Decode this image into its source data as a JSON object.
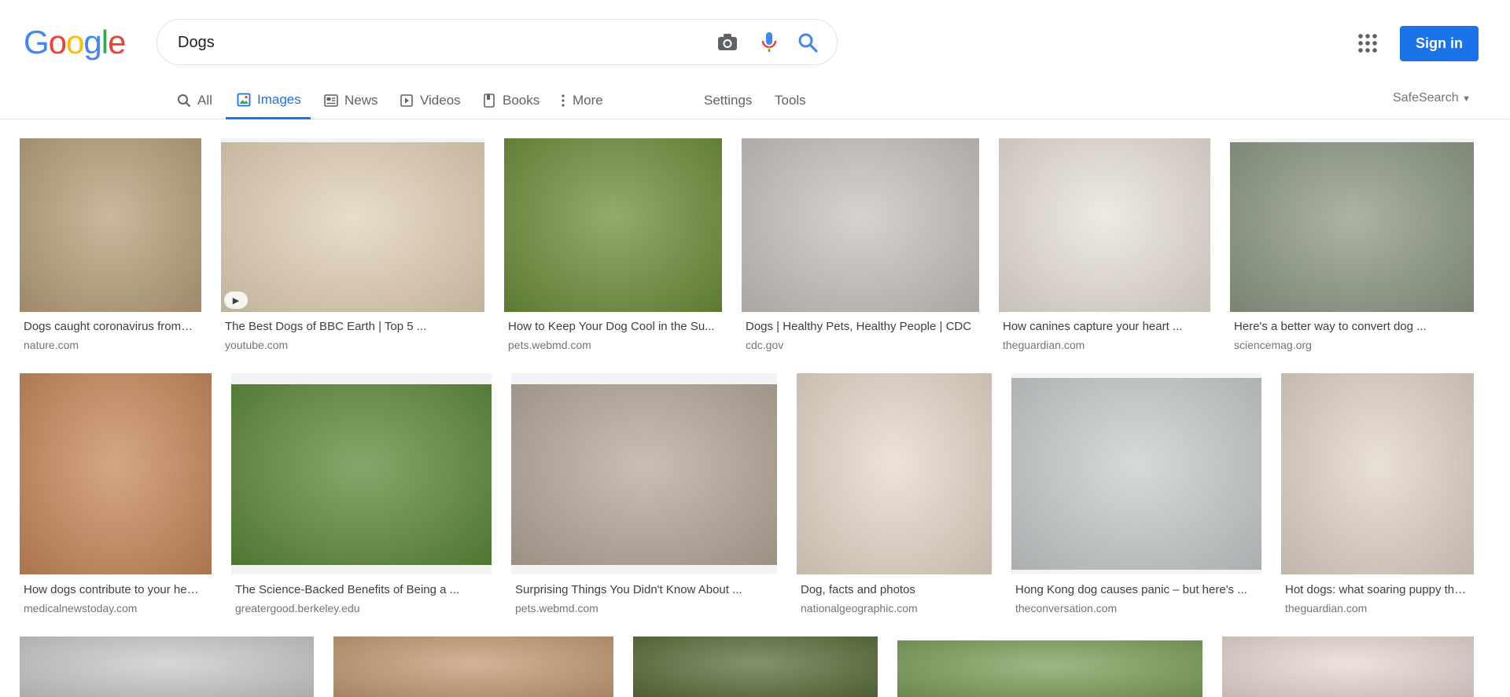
{
  "logo": [
    "G",
    "o",
    "o",
    "g",
    "l",
    "e"
  ],
  "logo_colors": [
    "#4285F4",
    "#EA4335",
    "#FBBC05",
    "#4285F4",
    "#34A853",
    "#EA4335"
  ],
  "search": {
    "value": "Dogs"
  },
  "signin_label": "Sign in",
  "tabs": [
    {
      "label": "All",
      "icon": "search-icon"
    },
    {
      "label": "Images",
      "icon": "image-icon"
    },
    {
      "label": "News",
      "icon": "news-icon"
    },
    {
      "label": "Videos",
      "icon": "video-icon"
    },
    {
      "label": "Books",
      "icon": "book-icon"
    },
    {
      "label": "More",
      "icon": "more-vert-icon"
    },
    {
      "label": "Settings"
    },
    {
      "label": "Tools"
    }
  ],
  "safesearch_label": "SafeSearch",
  "accent": "#1a73e8",
  "results": [
    {
      "title": "Dogs caught coronavirus from…",
      "source": "nature.com",
      "bg": "#b9a17c"
    },
    {
      "title": "The Best Dogs of BBC Earth | Top 5 ...",
      "source": "youtube.com",
      "bg": "#e3d2b6",
      "video": true
    },
    {
      "title": "How to Keep Your Dog Cool in the Su...",
      "source": "pets.webmd.com",
      "bg": "#6d8f3a"
    },
    {
      "title": "Dogs | Healthy Pets, Healthy People | CDC",
      "source": "cdc.gov",
      "bg": "#c7c3bf"
    },
    {
      "title": "How canines capture your heart ...",
      "source": "theguardian.com",
      "bg": "#e9e2d8"
    },
    {
      "title": "Here's a better way to convert dog ...",
      "source": "sciencemag.org",
      "bg": "#8e9a86"
    },
    {
      "title": "How dogs contribute to your he…",
      "source": "medicalnewstoday.com",
      "bg": "#c8895a"
    },
    {
      "title": "The Science-Backed Benefits of Being a ...",
      "source": "greatergood.berkeley.edu",
      "bg": "#5d8a3a"
    },
    {
      "title": "Surprising Things You Didn't Know About ...",
      "source": "pets.webmd.com",
      "bg": "#b7a99a"
    },
    {
      "title": "Dog, facts and photos",
      "source": "nationalgeographic.com",
      "bg": "#e7d9c9"
    },
    {
      "title": "Hong Kong dog causes panic – but here's ...",
      "source": "theconversation.com",
      "bg": "#c9ccce"
    },
    {
      "title": "Hot dogs: what soaring puppy th…",
      "source": "theguardian.com",
      "bg": "#e2d5c7"
    },
    {
      "bg": "#c9cacb"
    },
    {
      "bg": "#c49a74"
    },
    {
      "bg": "#5b6e3b"
    },
    {
      "bg": "#7da05a"
    },
    {
      "bg": "#e8d8d0"
    }
  ]
}
